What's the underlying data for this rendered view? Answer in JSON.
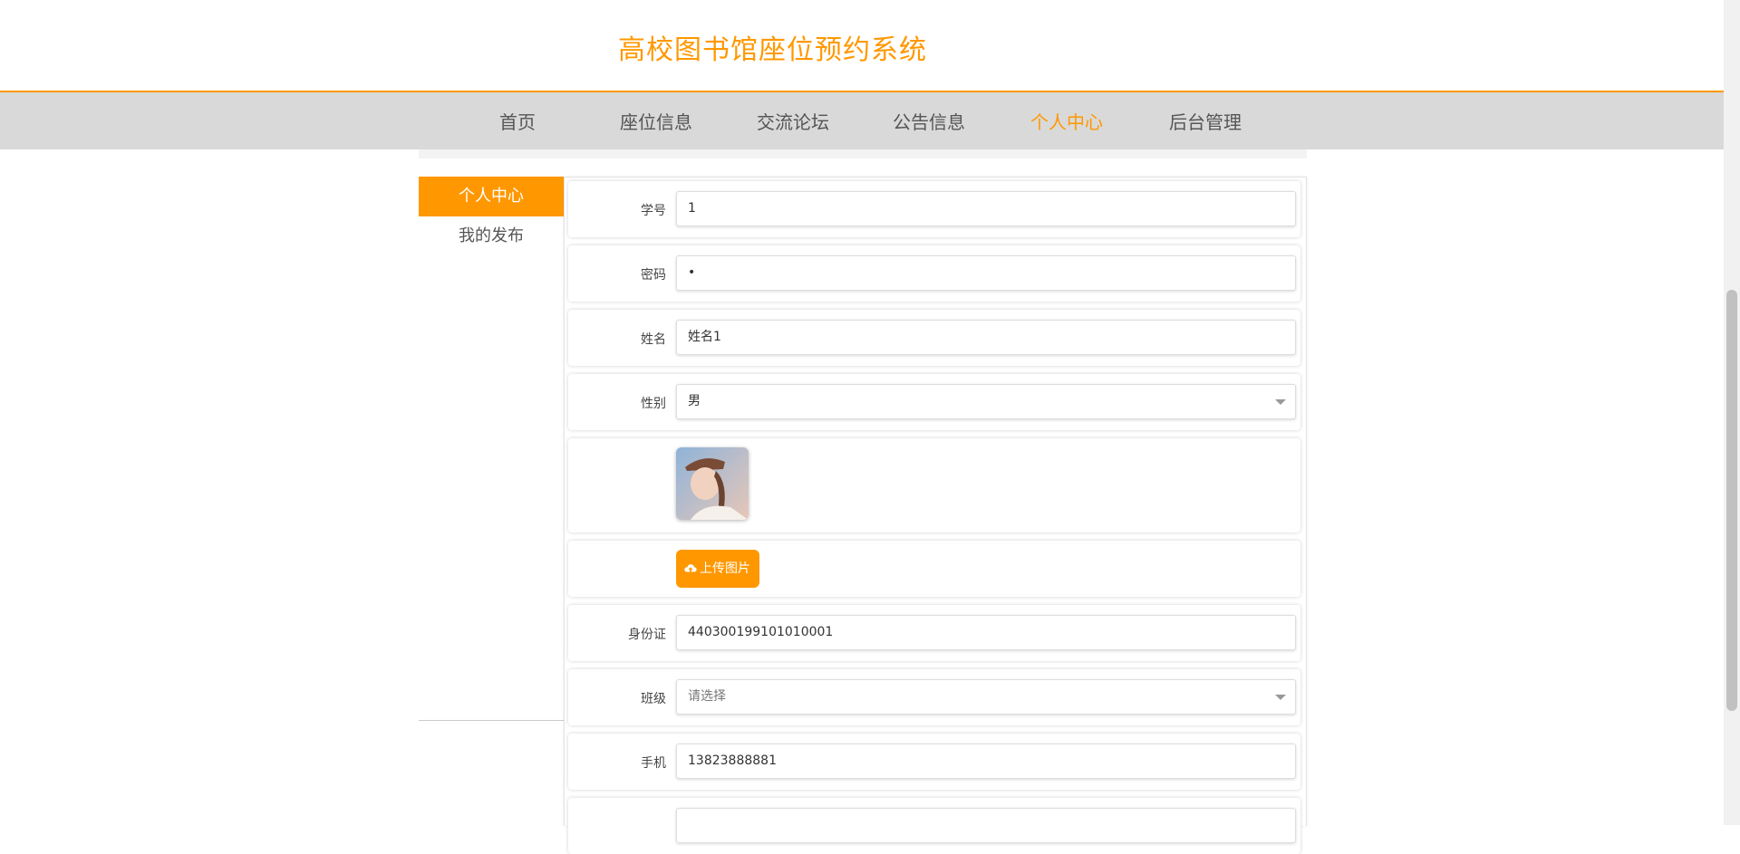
{
  "site": {
    "title": "高校图书馆座位预约系统"
  },
  "nav": {
    "items": [
      "首页",
      "座位信息",
      "交流论坛",
      "公告信息",
      "个人中心",
      "后台管理"
    ],
    "active": "个人中心"
  },
  "sidebar": {
    "items": [
      "个人中心",
      "我的发布"
    ],
    "active": "个人中心"
  },
  "form": {
    "student_id": {
      "label": "学号",
      "value": "1"
    },
    "password": {
      "label": "密码",
      "value": "•"
    },
    "name": {
      "label": "姓名",
      "value": "姓名1"
    },
    "gender": {
      "label": "性别",
      "value": "男"
    },
    "avatar": {
      "icon": "avatar-photo"
    },
    "upload": {
      "label": "上传图片",
      "icon": "cloud-upload-icon"
    },
    "id_card": {
      "label": "身份证",
      "value": "440300199101010001"
    },
    "class": {
      "label": "班级",
      "placeholder": "请选择"
    },
    "phone": {
      "label": "手机",
      "value": "13823888881"
    }
  },
  "colors": {
    "accent": "#ff9800",
    "nav_bg": "#d9d9d9"
  }
}
